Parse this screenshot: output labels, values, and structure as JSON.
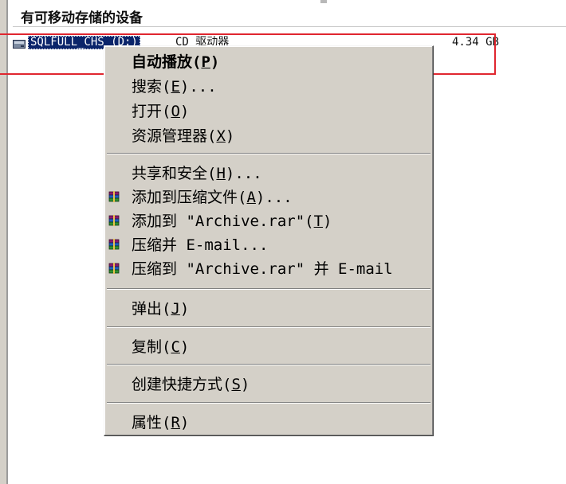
{
  "section": {
    "title": "有可移动存储的设备"
  },
  "drive": {
    "name": "SQLFULL_CHS (D:)",
    "type": "CD 驱动器",
    "size": "4.34 GB",
    "icon": "cd-drive-icon"
  },
  "context_menu": {
    "items": [
      {
        "text": "自动播放(",
        "accel": "P",
        "tail": ")",
        "default": true
      },
      {
        "text": "搜索(",
        "accel": "E",
        "tail": ")..."
      },
      {
        "text": "打开(",
        "accel": "O",
        "tail": ")"
      },
      {
        "text": "资源管理器(",
        "accel": "X",
        "tail": ")"
      },
      {
        "text": "共享和安全(",
        "accel": "H",
        "tail": ")..."
      },
      {
        "text": "添加到压缩文件(",
        "accel": "A",
        "tail": ")...",
        "icon": "winrar-icon"
      },
      {
        "text": "添加到 \"Archive.rar\"(",
        "accel": "T",
        "tail": ")",
        "icon": "winrar-icon"
      },
      {
        "text": "压缩并 E-mail...",
        "accel": "",
        "tail": "",
        "icon": "winrar-icon"
      },
      {
        "text": "压缩到 \"Archive.rar\" 并 E-mail",
        "accel": "",
        "tail": "",
        "icon": "winrar-icon"
      },
      {
        "text": "弹出(",
        "accel": "J",
        "tail": ")"
      },
      {
        "text": "复制(",
        "accel": "C",
        "tail": ")"
      },
      {
        "text": "创建快捷方式(",
        "accel": "S",
        "tail": ")"
      },
      {
        "text": "属性(",
        "accel": "R",
        "tail": ")"
      }
    ]
  },
  "colors": {
    "menu_background": "#d4d0c8",
    "selection": "#0a246a",
    "annotation_box": "#e0262f"
  }
}
